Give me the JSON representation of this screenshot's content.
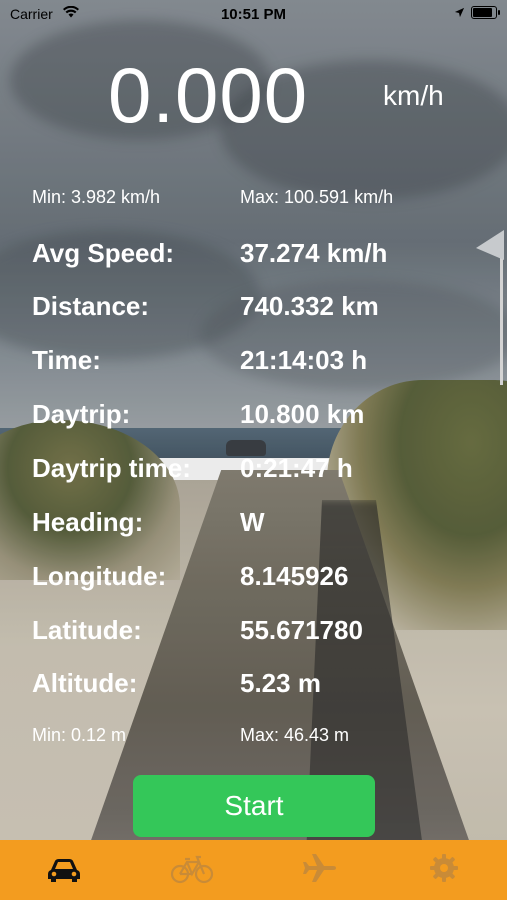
{
  "status_bar": {
    "carrier": "Carrier",
    "time": "10:51 PM"
  },
  "speed": {
    "value": "0.000",
    "unit": "km/h",
    "min": "Min: 3.982 km/h",
    "max": "Max: 100.591 km/h"
  },
  "stats": [
    {
      "label": "Avg Speed:",
      "value": "37.274 km/h"
    },
    {
      "label": "Distance:",
      "value": "740.332 km"
    },
    {
      "label": "Time:",
      "value": "21:14:03 h"
    },
    {
      "label": "Daytrip:",
      "value": "10.800 km"
    },
    {
      "label": "Daytrip time:",
      "value": "0:21:47 h"
    },
    {
      "label": "Heading:",
      "value": "W"
    },
    {
      "label": "Longitude:",
      "value": "8.145926"
    },
    {
      "label": "Latitude:",
      "value": "55.671780"
    },
    {
      "label": "Altitude:",
      "value": "5.23 m"
    }
  ],
  "altitude": {
    "min": "Min: 0.12 m",
    "max": "Max: 46.43 m"
  },
  "start_button": {
    "label": "Start",
    "color": "#34c759"
  },
  "tab_bar": {
    "color": "#f39c1f",
    "tabs": [
      {
        "icon": "car-icon",
        "selected": true
      },
      {
        "icon": "bicycle-icon",
        "selected": false
      },
      {
        "icon": "airplane-icon",
        "selected": false
      },
      {
        "icon": "gear-icon",
        "selected": false
      }
    ]
  }
}
